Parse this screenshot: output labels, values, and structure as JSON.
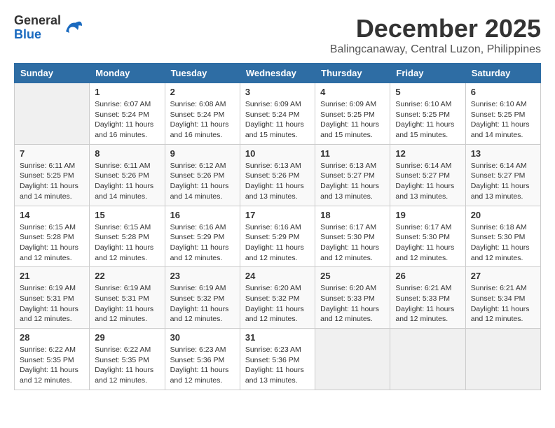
{
  "logo": {
    "general": "General",
    "blue": "Blue"
  },
  "title": "December 2025",
  "location": "Balingcanaway, Central Luzon, Philippines",
  "days_of_week": [
    "Sunday",
    "Monday",
    "Tuesday",
    "Wednesday",
    "Thursday",
    "Friday",
    "Saturday"
  ],
  "weeks": [
    [
      {
        "day": "",
        "empty": true
      },
      {
        "day": "1",
        "sunrise": "6:07 AM",
        "sunset": "5:24 PM",
        "daylight": "11 hours and 16 minutes."
      },
      {
        "day": "2",
        "sunrise": "6:08 AM",
        "sunset": "5:24 PM",
        "daylight": "11 hours and 16 minutes."
      },
      {
        "day": "3",
        "sunrise": "6:09 AM",
        "sunset": "5:24 PM",
        "daylight": "11 hours and 15 minutes."
      },
      {
        "day": "4",
        "sunrise": "6:09 AM",
        "sunset": "5:25 PM",
        "daylight": "11 hours and 15 minutes."
      },
      {
        "day": "5",
        "sunrise": "6:10 AM",
        "sunset": "5:25 PM",
        "daylight": "11 hours and 15 minutes."
      },
      {
        "day": "6",
        "sunrise": "6:10 AM",
        "sunset": "5:25 PM",
        "daylight": "11 hours and 14 minutes."
      }
    ],
    [
      {
        "day": "7",
        "sunrise": "6:11 AM",
        "sunset": "5:25 PM",
        "daylight": "11 hours and 14 minutes."
      },
      {
        "day": "8",
        "sunrise": "6:11 AM",
        "sunset": "5:26 PM",
        "daylight": "11 hours and 14 minutes."
      },
      {
        "day": "9",
        "sunrise": "6:12 AM",
        "sunset": "5:26 PM",
        "daylight": "11 hours and 14 minutes."
      },
      {
        "day": "10",
        "sunrise": "6:13 AM",
        "sunset": "5:26 PM",
        "daylight": "11 hours and 13 minutes."
      },
      {
        "day": "11",
        "sunrise": "6:13 AM",
        "sunset": "5:27 PM",
        "daylight": "11 hours and 13 minutes."
      },
      {
        "day": "12",
        "sunrise": "6:14 AM",
        "sunset": "5:27 PM",
        "daylight": "11 hours and 13 minutes."
      },
      {
        "day": "13",
        "sunrise": "6:14 AM",
        "sunset": "5:27 PM",
        "daylight": "11 hours and 13 minutes."
      }
    ],
    [
      {
        "day": "14",
        "sunrise": "6:15 AM",
        "sunset": "5:28 PM",
        "daylight": "11 hours and 12 minutes."
      },
      {
        "day": "15",
        "sunrise": "6:15 AM",
        "sunset": "5:28 PM",
        "daylight": "11 hours and 12 minutes."
      },
      {
        "day": "16",
        "sunrise": "6:16 AM",
        "sunset": "5:29 PM",
        "daylight": "11 hours and 12 minutes."
      },
      {
        "day": "17",
        "sunrise": "6:16 AM",
        "sunset": "5:29 PM",
        "daylight": "11 hours and 12 minutes."
      },
      {
        "day": "18",
        "sunrise": "6:17 AM",
        "sunset": "5:30 PM",
        "daylight": "11 hours and 12 minutes."
      },
      {
        "day": "19",
        "sunrise": "6:17 AM",
        "sunset": "5:30 PM",
        "daylight": "11 hours and 12 minutes."
      },
      {
        "day": "20",
        "sunrise": "6:18 AM",
        "sunset": "5:30 PM",
        "daylight": "11 hours and 12 minutes."
      }
    ],
    [
      {
        "day": "21",
        "sunrise": "6:19 AM",
        "sunset": "5:31 PM",
        "daylight": "11 hours and 12 minutes."
      },
      {
        "day": "22",
        "sunrise": "6:19 AM",
        "sunset": "5:31 PM",
        "daylight": "11 hours and 12 minutes."
      },
      {
        "day": "23",
        "sunrise": "6:19 AM",
        "sunset": "5:32 PM",
        "daylight": "11 hours and 12 minutes."
      },
      {
        "day": "24",
        "sunrise": "6:20 AM",
        "sunset": "5:32 PM",
        "daylight": "11 hours and 12 minutes."
      },
      {
        "day": "25",
        "sunrise": "6:20 AM",
        "sunset": "5:33 PM",
        "daylight": "11 hours and 12 minutes."
      },
      {
        "day": "26",
        "sunrise": "6:21 AM",
        "sunset": "5:33 PM",
        "daylight": "11 hours and 12 minutes."
      },
      {
        "day": "27",
        "sunrise": "6:21 AM",
        "sunset": "5:34 PM",
        "daylight": "11 hours and 12 minutes."
      }
    ],
    [
      {
        "day": "28",
        "sunrise": "6:22 AM",
        "sunset": "5:35 PM",
        "daylight": "11 hours and 12 minutes."
      },
      {
        "day": "29",
        "sunrise": "6:22 AM",
        "sunset": "5:35 PM",
        "daylight": "11 hours and 12 minutes."
      },
      {
        "day": "30",
        "sunrise": "6:23 AM",
        "sunset": "5:36 PM",
        "daylight": "11 hours and 12 minutes."
      },
      {
        "day": "31",
        "sunrise": "6:23 AM",
        "sunset": "5:36 PM",
        "daylight": "11 hours and 13 minutes."
      },
      {
        "day": "",
        "empty": true
      },
      {
        "day": "",
        "empty": true
      },
      {
        "day": "",
        "empty": true
      }
    ]
  ],
  "labels": {
    "sunrise": "Sunrise:",
    "sunset": "Sunset:",
    "daylight": "Daylight:"
  }
}
